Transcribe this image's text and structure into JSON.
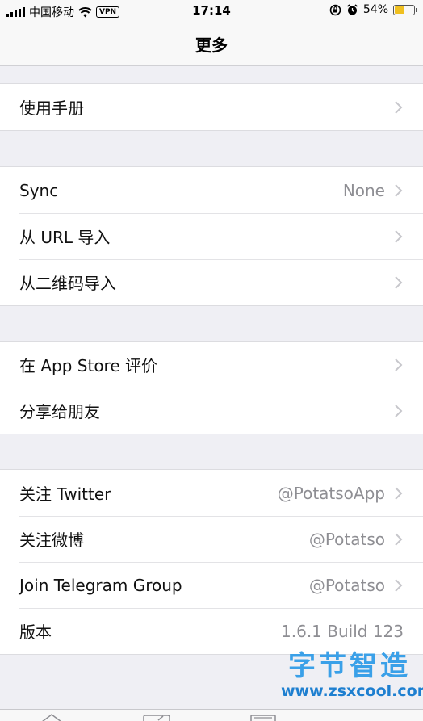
{
  "status_bar": {
    "carrier": "中国移动",
    "vpn": "VPN",
    "time": "17:14",
    "battery": "54%",
    "battery_level": 0.54
  },
  "nav": {
    "title": "更多"
  },
  "groups": [
    {
      "rows": [
        {
          "label": "使用手册",
          "value": ""
        }
      ]
    },
    {
      "rows": [
        {
          "label": "Sync",
          "value": "None"
        },
        {
          "label": "从 URL 导入",
          "value": ""
        },
        {
          "label": "从二维码导入",
          "value": ""
        }
      ]
    },
    {
      "rows": [
        {
          "label": "在 App Store 评价",
          "value": ""
        },
        {
          "label": "分享给朋友",
          "value": ""
        }
      ]
    },
    {
      "rows": [
        {
          "label": "关注 Twitter",
          "value": "@PotatsoApp"
        },
        {
          "label": "关注微博",
          "value": "@Potatso"
        },
        {
          "label": "Join Telegram Group",
          "value": "@Potatso"
        },
        {
          "label": "版本",
          "value": "1.6.1 Build 123"
        }
      ]
    }
  ],
  "watermark": {
    "title": "字节智造",
    "url": "www.zsxcool.com"
  },
  "colors": {
    "background": "#efeff4",
    "secondary_text": "#8e8e93",
    "battery": "#f0c020"
  }
}
